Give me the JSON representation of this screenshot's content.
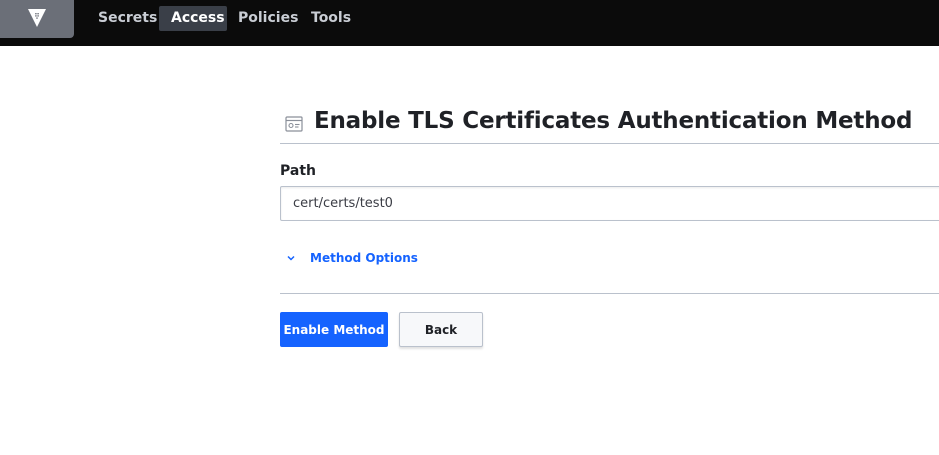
{
  "nav": {
    "logo_icon": "vault-logo-icon",
    "items": [
      {
        "label": "Secrets",
        "active": false
      },
      {
        "label": "Access",
        "active": true
      },
      {
        "label": "Policies",
        "active": false
      },
      {
        "label": "Tools",
        "active": false
      }
    ]
  },
  "page": {
    "title_icon": "certificate-icon",
    "title": "Enable TLS Certificates Authentication Method"
  },
  "form": {
    "path_label": "Path",
    "path_value": "cert/certs/test0",
    "options_toggle_label": "Method Options",
    "options_toggle_icon": "chevron-down-icon"
  },
  "actions": {
    "enable_label": "Enable Method",
    "back_label": "Back"
  },
  "colors": {
    "accent": "#1563ff",
    "topbar": "#0b0b0b",
    "active_nav": "#3a3f48"
  }
}
